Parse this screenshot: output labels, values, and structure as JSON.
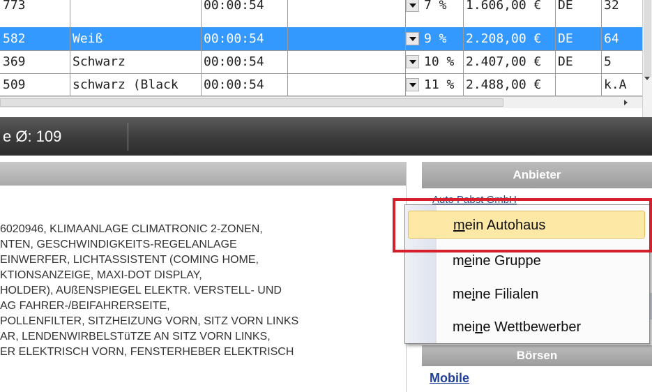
{
  "grid": {
    "rows": [
      {
        "id": "773",
        "color": "",
        "time": "00:00:54",
        "pct": "7 %",
        "price": "1.606,00 €",
        "land": "DE",
        "count": "32",
        "selected": false
      },
      {
        "id": "582",
        "color": "Weiß",
        "time": "00:00:54",
        "pct": "9 %",
        "price": "2.208,00 €",
        "land": "DE",
        "count": "64",
        "selected": true
      },
      {
        "id": "369",
        "color": "Schwarz",
        "time": "00:00:54",
        "pct": "10 %",
        "price": "2.407,00 €",
        "land": "DE",
        "count": "5",
        "selected": false
      },
      {
        "id": "509",
        "color": "schwarz (Black",
        "time": "00:00:54",
        "pct": "11 %",
        "price": "2.488,00 €",
        "land": "",
        "count": "k.A",
        "selected": false
      }
    ]
  },
  "statusbar": {
    "text": "e Ø: 109"
  },
  "description": {
    "lines": [
      "6020946, KLIMAANLAGE CLIMATRONIC 2-ZONEN,",
      "NTEN, GESCHWINDIGKEITS-REGELANLAGE",
      "EINWERFER, LICHTASSISTENT (COMING HOME,",
      "KTIONSANZEIGE, MAXI-DOT DISPLAY,",
      "HOLDER), AUßENSPIEGEL ELEKTR. VERSTELL- UND",
      "AG FAHRER-/BEIFAHRERSEITE,",
      "POLLENFILTER, SITZHEIZUNG VORN, SITZ VORN LINKS",
      "AR, LENDENWIRBELSTüTZE AN SITZ VORN LINKS,",
      "ER ELEKTRISCH VORN, FENSTERHEBER ELEKTRISCH"
    ]
  },
  "right_panel": {
    "header": "Anbieter",
    "dealer_name": "Auto Pabst GmbH",
    "boersen_header": "Börsen",
    "mobile_link": "Mobile"
  },
  "context_menu": {
    "items": [
      {
        "pre": "",
        "u": "m",
        "post": "ein Autohaus",
        "highlighted": true
      },
      {
        "pre": "m",
        "u": "e",
        "post": "ine Gruppe",
        "highlighted": false
      },
      {
        "pre": "me",
        "u": "i",
        "post": "ne Filialen",
        "highlighted": false
      },
      {
        "pre": "mei",
        "u": "n",
        "post": "e Wettbewerber",
        "highlighted": false
      }
    ]
  },
  "colors": {
    "selection": "#3399ff",
    "highlight": "#fde8a6",
    "annotation_red": "#d4202c"
  }
}
